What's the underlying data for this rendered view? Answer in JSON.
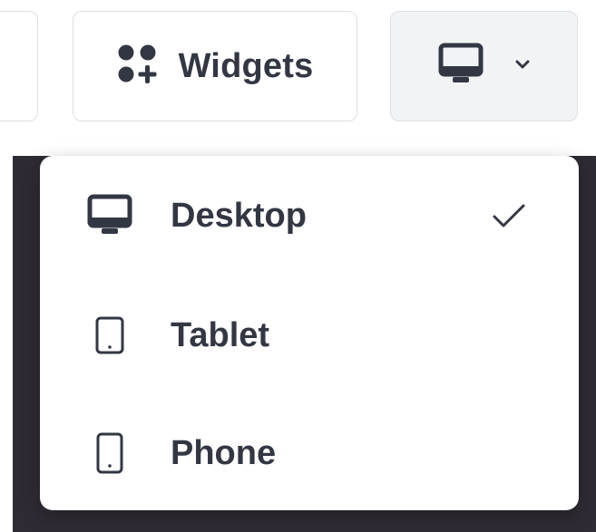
{
  "toolbar": {
    "widgets_label": "Widgets",
    "device_button": {
      "icon": "desktop-icon",
      "dropdown_icon": "chevron-down-icon"
    }
  },
  "device_menu": {
    "selected": "Desktop",
    "items": [
      {
        "label": "Desktop",
        "icon": "desktop-icon",
        "selected": true
      },
      {
        "label": "Tablet",
        "icon": "tablet-icon",
        "selected": false
      },
      {
        "label": "Phone",
        "icon": "phone-icon",
        "selected": false
      }
    ]
  },
  "colors": {
    "text": "#333743",
    "border": "#dcdfe4",
    "active_button_bg": "#f2f3f5",
    "canvas_bg": "#2f2b34"
  }
}
